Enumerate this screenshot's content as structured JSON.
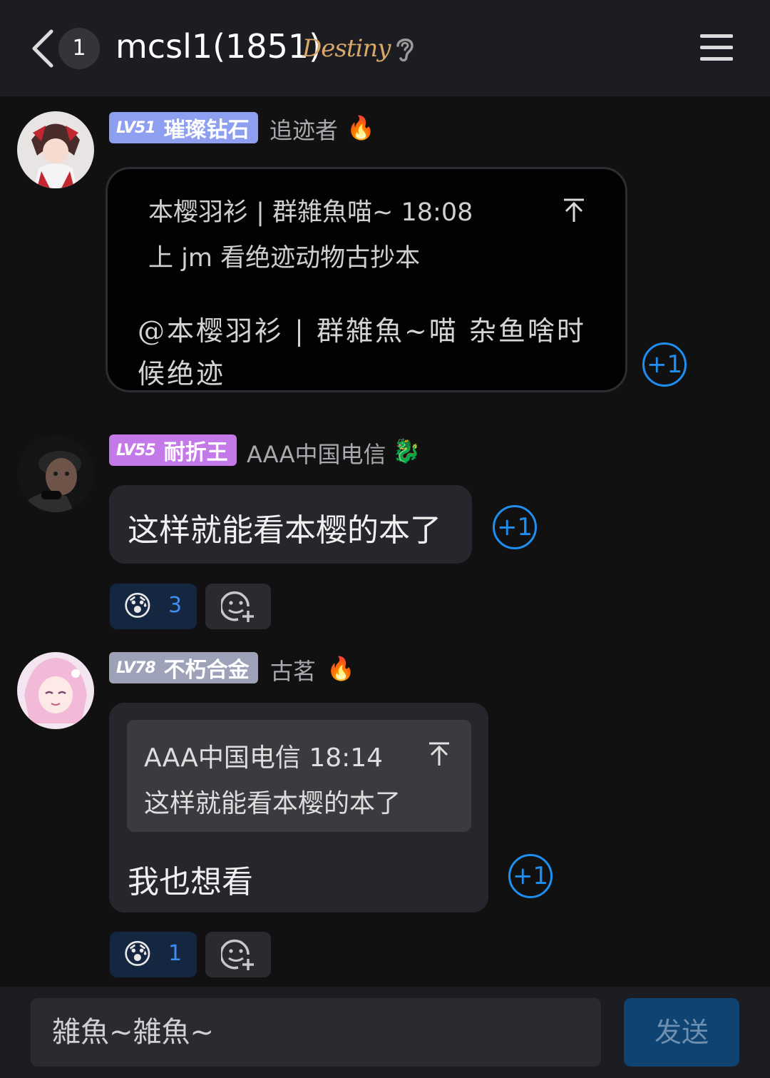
{
  "header": {
    "unread_count": "1",
    "title": "mcsl1(1851)",
    "title_decoration": "Destiny",
    "back_icon": "chevron-left-icon",
    "ear_icon": "ear-icon",
    "menu_icon": "hamburger-menu-icon"
  },
  "messages": [
    {
      "level": "LV51",
      "rank": "璀璨钻石",
      "badge_color": "#8f9ff0",
      "name": "追迹者",
      "name_emoji": "🔥",
      "quote_header": "本樱羽衫 | 群雑魚喵~ 18:08",
      "quote_text": "上 jm 看绝迹动物古抄本",
      "text_line1": "@本樱羽衫 | 群雑魚~喵 杂鱼啥时",
      "text_line2": "候绝迹",
      "plus": "+1"
    },
    {
      "level": "LV55",
      "rank": "耐折王",
      "badge_color": "#c479e8",
      "name": "AAA中国电信",
      "name_emoji": "🐉",
      "text": "这样就能看本樱的本了",
      "plus": "+1",
      "reaction_emoji": "😰",
      "reaction_count": "3"
    },
    {
      "level": "LV78",
      "rank": "不朽合金",
      "badge_color": "#9ea2b8",
      "name": "古茗",
      "name_emoji": "🔥",
      "quote_header": "AAA中国电信 18:14",
      "quote_text": "这样就能看本樱的本了",
      "text": "我也想看",
      "plus": "+1",
      "reaction_emoji": "😰",
      "reaction_count": "1"
    }
  ],
  "input": {
    "value": "雑魚~雑魚~",
    "send_label": "发送"
  },
  "colors": {
    "accent": "#1e8ff0",
    "background": "#111111",
    "bubble": "#26272c"
  }
}
